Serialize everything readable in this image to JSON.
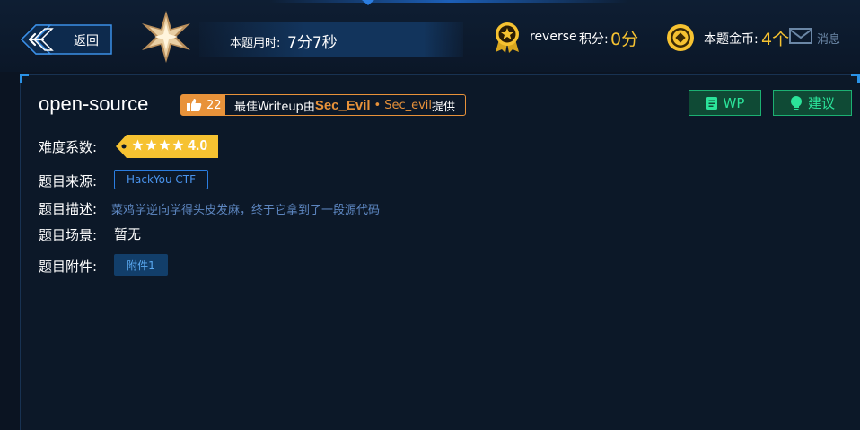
{
  "header": {
    "back_label": "返回",
    "timer_label": "本题用时:",
    "timer_value": "7分7秒",
    "username": "reverse",
    "score_label": "积分:",
    "score_value": "0分",
    "coins_label": "本题金币:",
    "coins_value": "4个",
    "messages_label": "消息"
  },
  "challenge": {
    "title": "open-source",
    "likes": "22",
    "writeup_prefix": "最佳Writeup由",
    "writeup_author": "Sec_Evil",
    "writeup_separator": "•",
    "writeup_team": "Sec_evil",
    "writeup_suffix": "提供",
    "wp_button": "WP",
    "suggest_button": "建议",
    "difficulty_label": "难度系数:",
    "difficulty_stars": 4,
    "difficulty_value": "4.0",
    "source_label": "题目来源:",
    "source_value": "HackYou CTF",
    "description_label": "题目描述:",
    "description_value": "菜鸡学逆向学得头皮发麻，终于它拿到了一段源代码",
    "scene_label": "题目场景:",
    "scene_value": "暂无",
    "attachment_label": "题目附件:",
    "attachment_value": "附件1"
  },
  "colors": {
    "accent_gold": "#f6c231",
    "accent_orange": "#e8923a",
    "accent_green": "#2be39a",
    "accent_blue": "#2b7de0",
    "background": "#0b1422"
  },
  "icons": {
    "back": "arrow-left-icon",
    "rank": "star-badge-icon",
    "medal": "medal-icon",
    "coin": "coin-icon",
    "mail": "mail-icon",
    "like": "thumbs-up-icon",
    "wp": "document-icon",
    "suggest": "lightbulb-icon"
  }
}
